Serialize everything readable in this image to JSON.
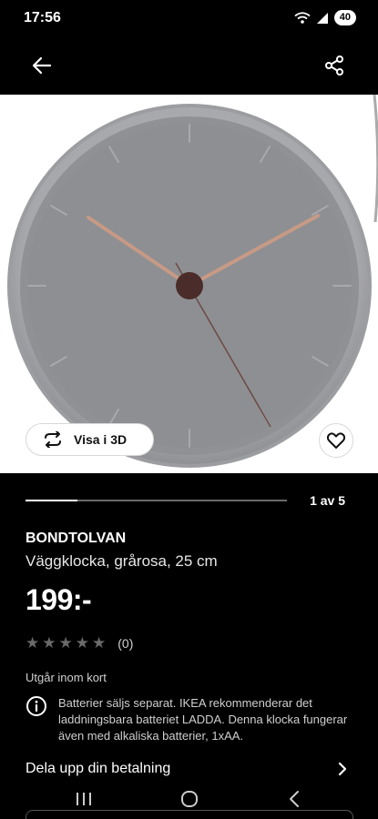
{
  "status_bar": {
    "time": "17:56",
    "battery": "40"
  },
  "app_bar": {
    "back_icon": "arrow-left-icon",
    "share_icon": "share-icon"
  },
  "gallery": {
    "view_3d_label": "Visa i 3D",
    "position": "1 av 5",
    "progress_fraction": 0.2,
    "favorite_icon": "heart-outline-icon"
  },
  "product": {
    "name": "BONDTOLVAN",
    "description": "Väggklocka, grårosa, 25 cm",
    "price": "199:-",
    "rating_count": "(0)",
    "rating_stars": 5,
    "availability": "Utgår inom kort",
    "info": "Batterier säljs separat. IKEA rekommenderar det laddningsbara batteriet LADDA. Denna klocka fungerar även med alkaliska batterier, 1xAA."
  },
  "payment": {
    "split_label": "Dela upp din betalning"
  },
  "colors": {
    "background": "#000000",
    "clock_face": "#8e8f92",
    "clock_hands": "#c79a86"
  }
}
